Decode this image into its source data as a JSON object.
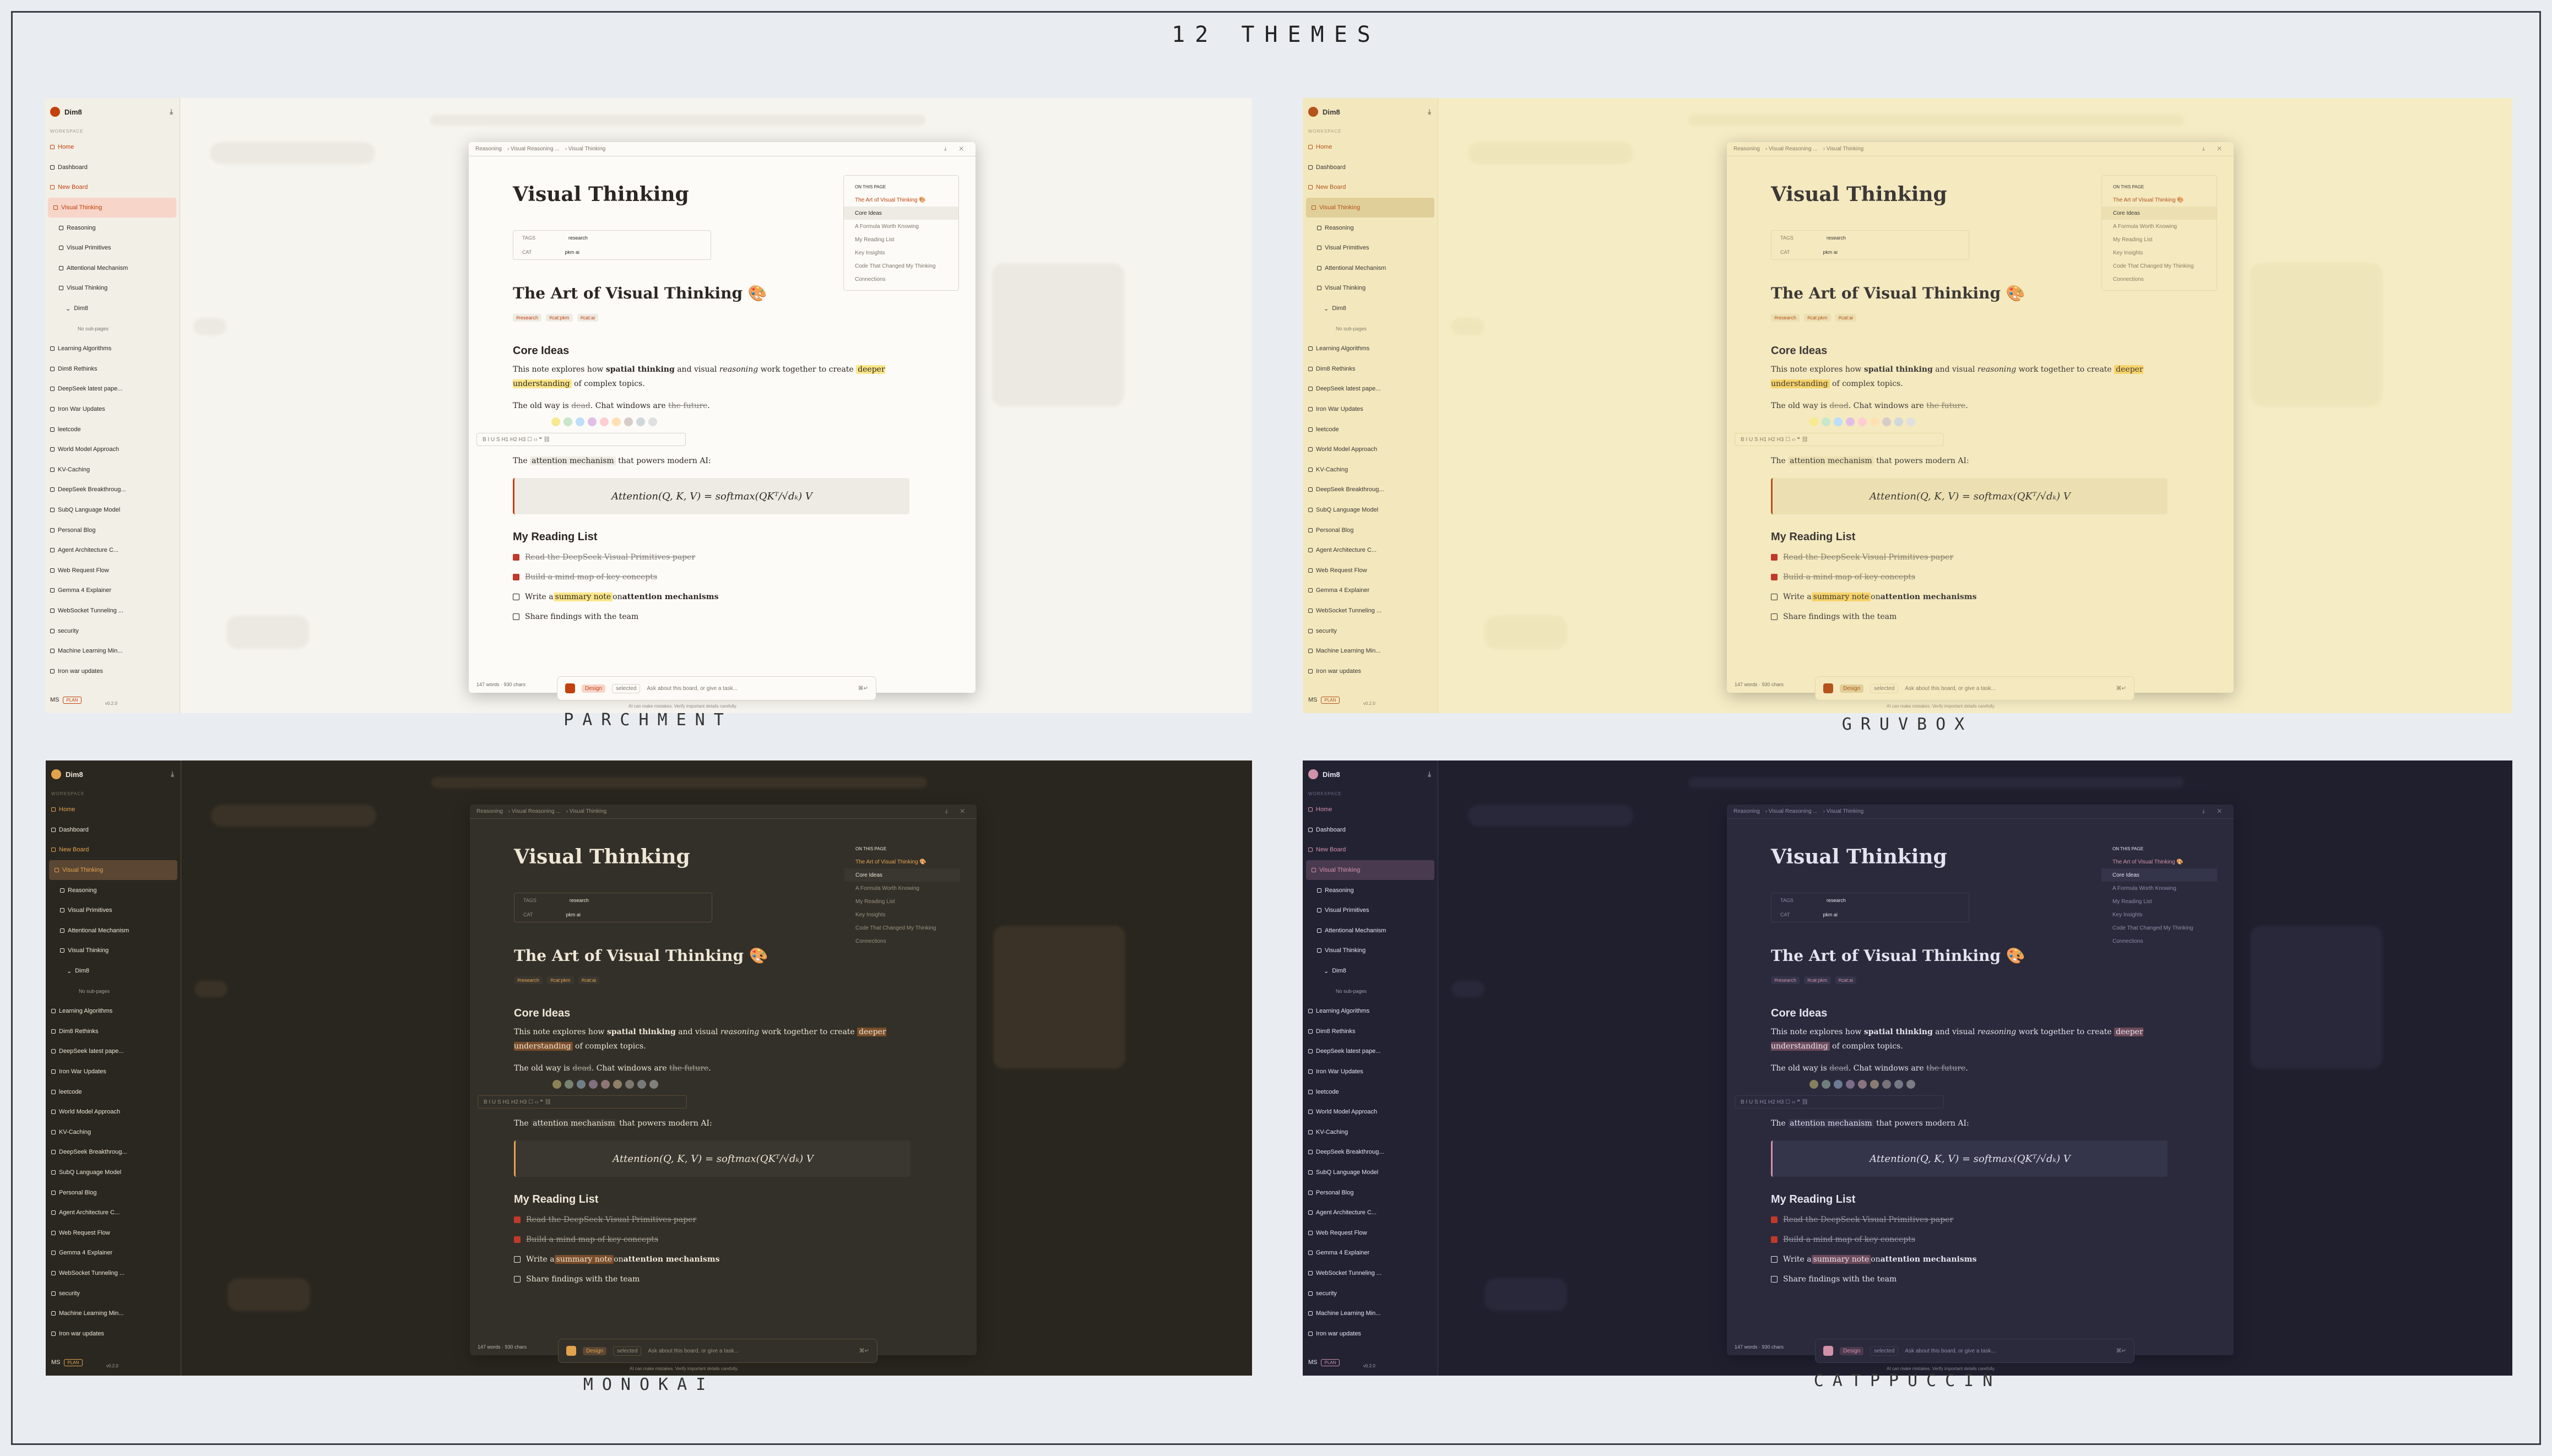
{
  "title": "12 THEMES",
  "panels": [
    {
      "theme": "PARCHMENT",
      "colors": {
        "bg": "#f6f4ee",
        "sidebar": "#f2efe7",
        "text": "#2b2621",
        "muted": "#7d756b",
        "doc": "#fcfbf7",
        "accent": "#c2410c",
        "active": "#f7d5c9",
        "hl": "#fbe68a",
        "math": "#eeebe4",
        "blur": "#d9d5cc"
      }
    },
    {
      "theme": "GRUVBOX",
      "colors": {
        "bg": "#f5ecc5",
        "sidebar": "#f3e8bd",
        "text": "#3c3836",
        "muted": "#8a7d63",
        "doc": "#f4e9bf",
        "accent": "#b5531c",
        "active": "#e1cf99",
        "hl": "#f7d36a",
        "math": "#ece0b2",
        "blur": "#e6d9a8"
      }
    },
    {
      "theme": "MONOKAI",
      "colors": {
        "bg": "#29261f",
        "sidebar": "#2a2721",
        "text": "#efe7d6",
        "muted": "#9a907c",
        "doc": "#33302a",
        "accent": "#e3a24c",
        "active": "#5a4633",
        "hl": "#7a4d2a",
        "math": "#3a3630",
        "blur": "#5a4a33"
      }
    },
    {
      "theme": "CATPPUCCIN",
      "colors": {
        "bg": "#1f1f2e",
        "sidebar": "#222233",
        "text": "#e4e4f0",
        "muted": "#8c8ca8",
        "doc": "#2a2a3c",
        "accent": "#d291a8",
        "active": "#4a3a50",
        "hl": "#6e4a5a",
        "math": "#34344a",
        "blur": "#3a3a52"
      }
    }
  ],
  "app": {
    "user": "Dim8",
    "workspace_label": "WORKSPACE",
    "nav": [
      "Home",
      "Dashboard",
      "New Board",
      "Visual Thinking"
    ],
    "sub_items": [
      "Reasoning",
      "Visual Primitives",
      "Attentional Mechanism",
      "Visual Thinking"
    ],
    "sub_sub": "Dim8",
    "no_sub": "No sub-pages",
    "boards": [
      "Learning Algorithms",
      "Dim8 Rethinks",
      "DeepSeek latest pape...",
      "Iron War Updates",
      "leetcode",
      "World Model Approach",
      "KV-Caching",
      "DeepSeek Breakthroug...",
      "SubQ Language Model",
      "Personal Blog",
      "Agent Architecture C...",
      "Web Request Flow",
      "Gemma 4 Explainer",
      "WebSocket Tunneling ...",
      "security",
      "Machine Learning Min...",
      "Iron war updates"
    ],
    "version": "v0.2.0",
    "footer_initials": "MS",
    "plan": "PLAN"
  },
  "doc": {
    "crumbs": [
      "Reasoning",
      "Visual Reasoning ...",
      "Visual Thinking"
    ],
    "controls": "⤓ ✕",
    "title": "Visual Thinking",
    "meta": [
      {
        "k": "TAGS",
        "v": "research"
      },
      {
        "k": "CAT",
        "v": "pkm   ai"
      }
    ],
    "heading": "The Art of Visual Thinking 🎨",
    "tags": [
      "#research",
      "#cat:pkm",
      "#cat:ai"
    ],
    "core_title": "Core Ideas",
    "core_a": "This note explores how ",
    "core_b": "spatial thinking",
    "core_c": " and visual ",
    "core_d": "reasoning",
    "core_e": " work together to create ",
    "core_f": "deeper understanding",
    "core_g": " of complex topics.",
    "old_a": "The old way is ",
    "old_b": "dead",
    "old_c": ". Chat windows are ",
    "old_d": "the future",
    "old_e": ".",
    "toolbar": "B  I  U  S   H1  H2  H3   ☐  ‹›  ❝  ⛓",
    "attn_a": "The ",
    "attn_b": "attention mechanism",
    "attn_c": " that powers modern AI:",
    "formula": "Attention(Q, K, V) = softmax(QKᵀ/√dₖ) V",
    "list_title": "My Reading List",
    "todos": [
      "Read the DeepSeek Visual Primitives paper",
      "Build a mind map of key concepts",
      "Write a ",
      "Share findings with the team"
    ],
    "todo3_hl": "summary note",
    "todo3_mid": " on ",
    "todo3_b": "attention mechanisms",
    "wc": "147 words · 930 chars",
    "otp_title": "ON THIS PAGE",
    "otp": [
      "The Art of Visual Thinking 🎨",
      "Core Ideas",
      "A Formula Worth Knowing",
      "My Reading List",
      "Key Insights",
      "Code That Changed My Thinking",
      "Connections"
    ]
  },
  "ask": {
    "pill1": "Design",
    "pill2": "selected",
    "placeholder": "Ask about this board, or give a task...",
    "kbd": "⌘↵"
  },
  "foot": "AI can make mistakes. Verify important details carefully."
}
